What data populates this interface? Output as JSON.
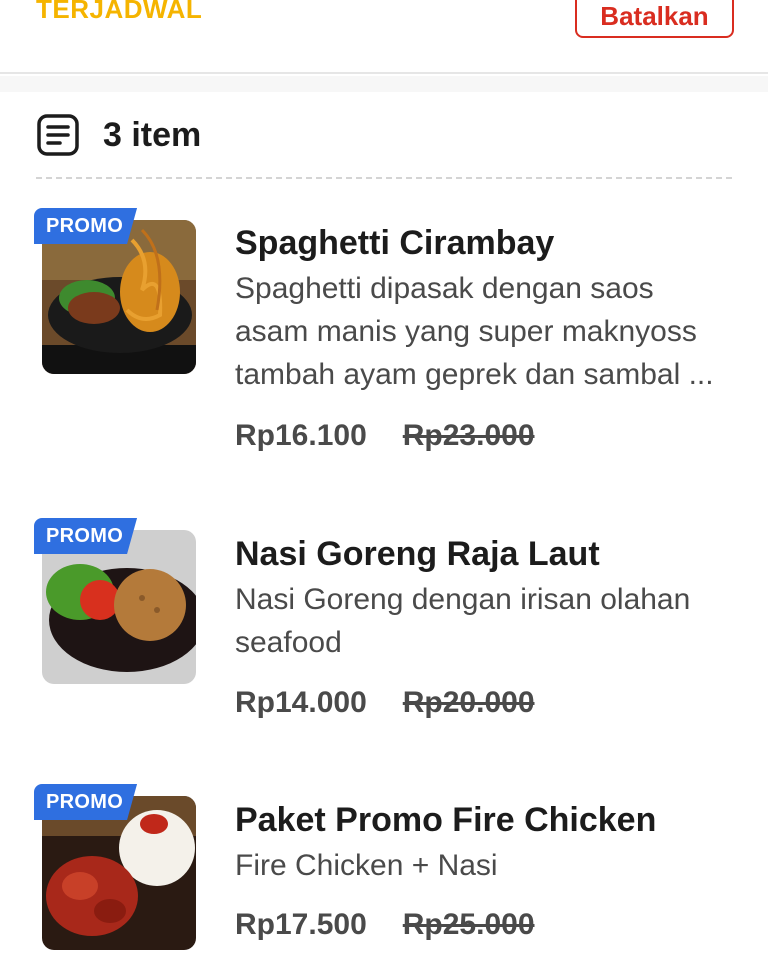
{
  "header": {
    "status_label": "TERJADWAL",
    "cancel_label": "Batalkan"
  },
  "order": {
    "items_count_label": "3 item"
  },
  "badge_label": "PROMO",
  "items": [
    {
      "name": "Spaghetti Cirambay",
      "description": "Spaghetti dipasak dengan saos asam manis yang super maknyoss tambah ayam geprek dan sambal ...",
      "price": "Rp16.100",
      "original_price": "Rp23.000"
    },
    {
      "name": "Nasi Goreng Raja Laut",
      "description": "Nasi Goreng dengan irisan olahan seafood",
      "price": "Rp14.000",
      "original_price": "Rp20.000"
    },
    {
      "name": "Paket Promo Fire Chicken",
      "description": "Fire Chicken + Nasi",
      "price": "Rp17.500",
      "original_price": "Rp25.000"
    }
  ],
  "colors": {
    "status": "#f5b400",
    "cancel": "#d92d20",
    "promo_badge": "#2f6fe0"
  },
  "icons": {
    "order_list": "list-document-icon"
  }
}
